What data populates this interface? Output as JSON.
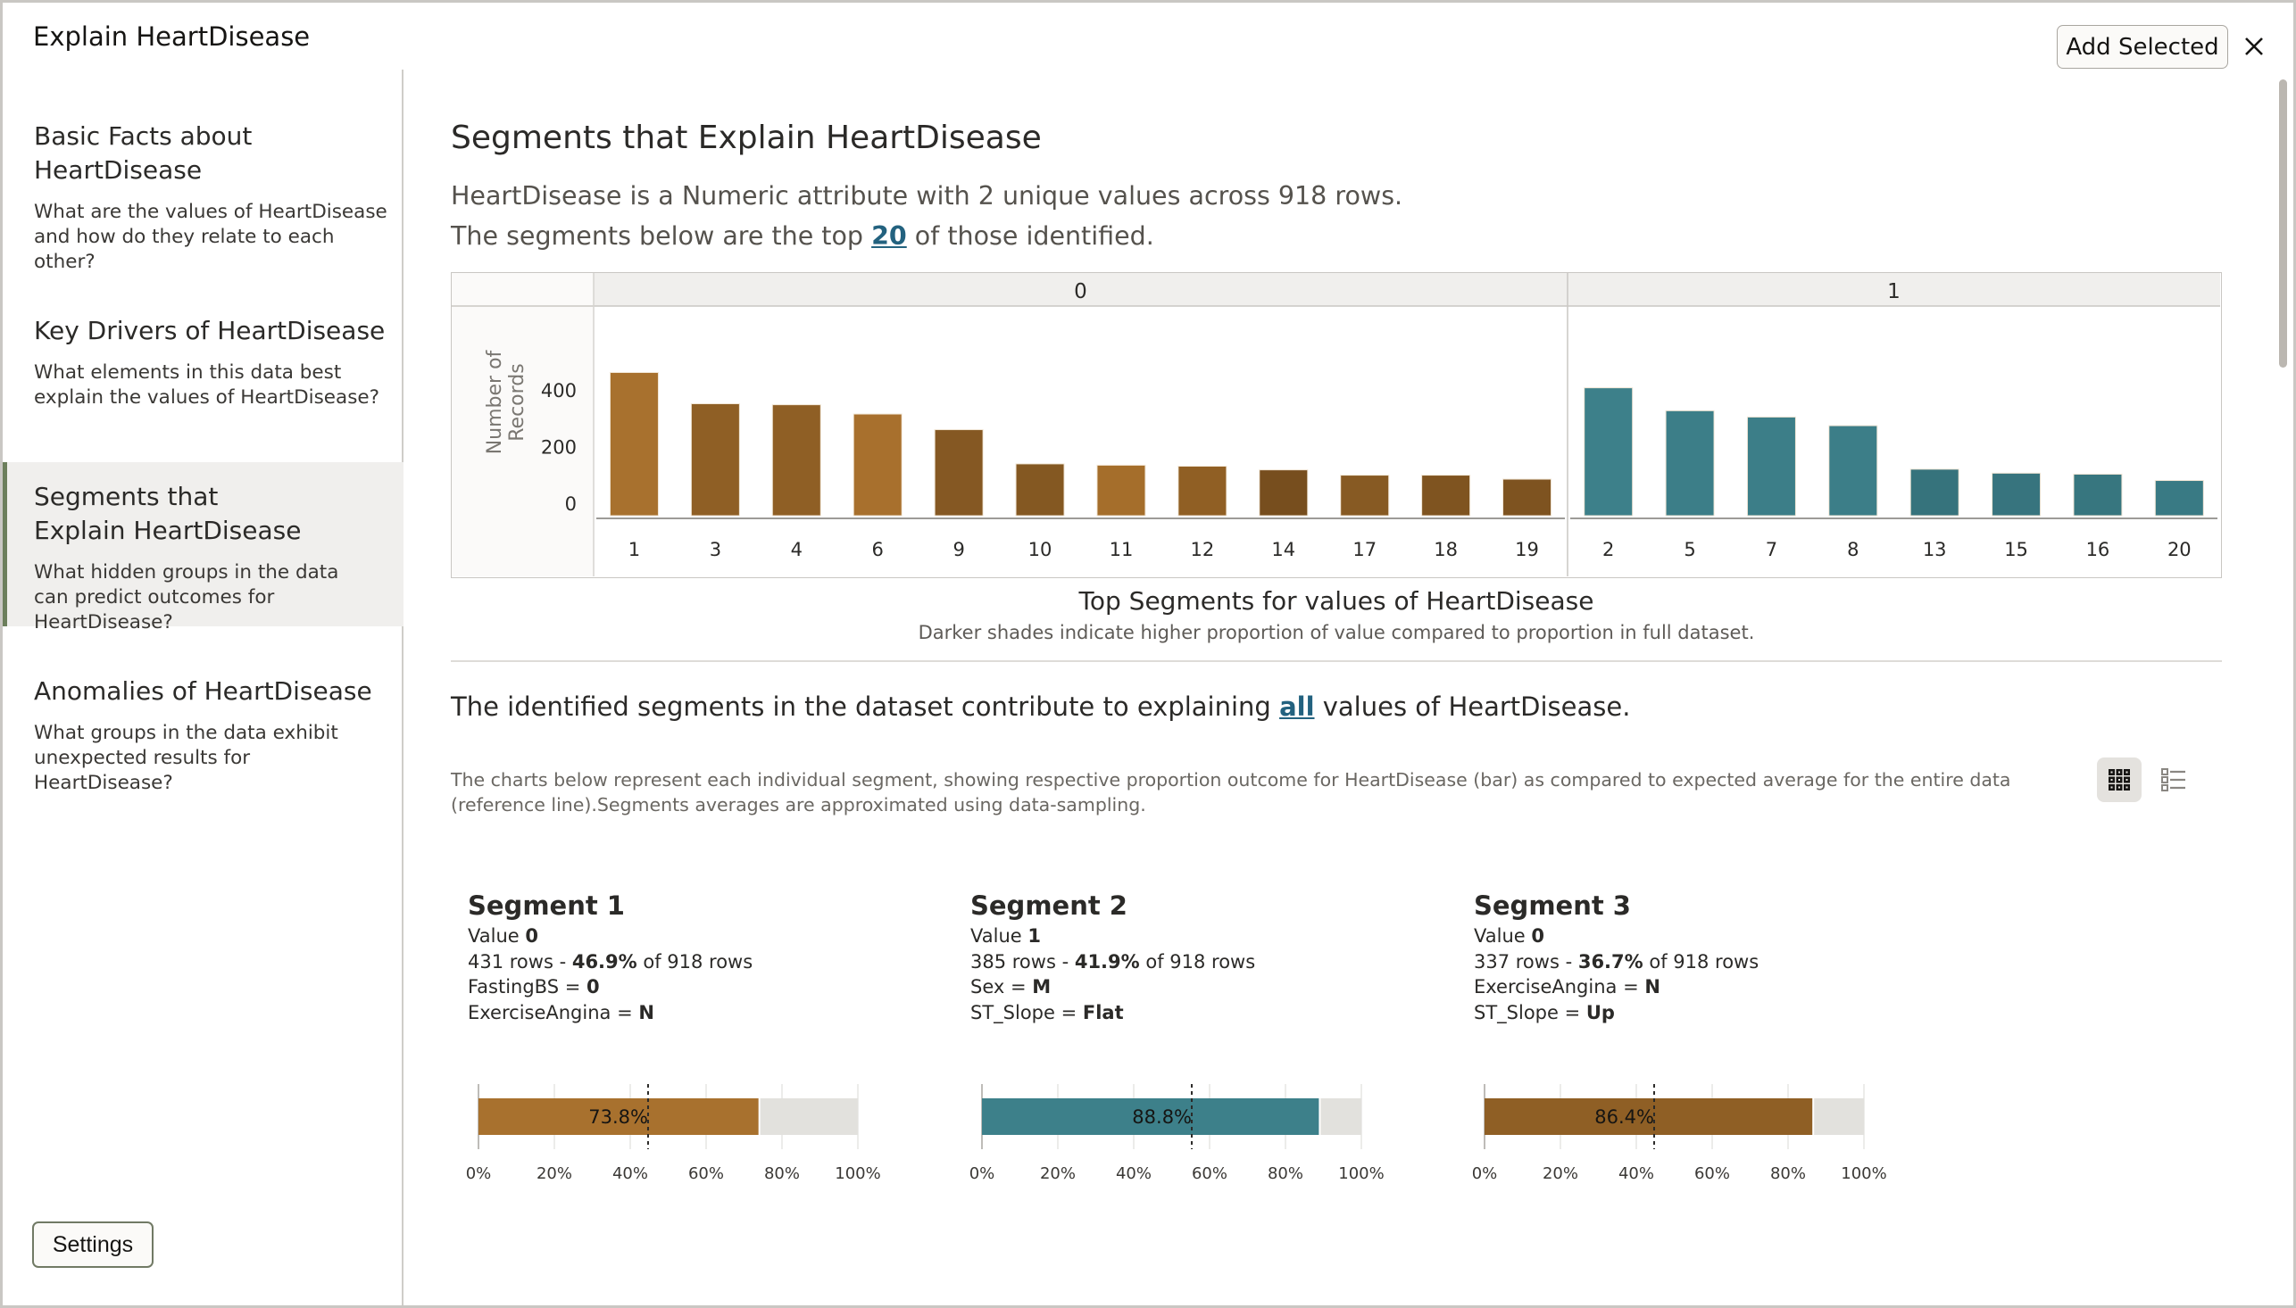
{
  "window": {
    "title": "Explain HeartDisease",
    "add_selected_label": "Add Selected",
    "close_icon": "close-icon"
  },
  "sidebar": {
    "items": [
      {
        "title": "Basic Facts about HeartDisease",
        "description": "What are the values of HeartDisease and how do they relate to each other?",
        "selected": false
      },
      {
        "title": "Key Drivers of HeartDisease",
        "description": "What elements in this data best explain the values of HeartDisease?",
        "selected": false
      },
      {
        "title": "Segments that Explain HeartDisease",
        "description": "What hidden groups in the data can predict outcomes for HeartDisease?",
        "selected": true
      },
      {
        "title": "Anomalies of HeartDisease",
        "description": "What groups in the data exhibit unexpected results for HeartDisease?",
        "selected": false
      }
    ],
    "settings_label": "Settings"
  },
  "main": {
    "heading": "Segments that Explain HeartDisease",
    "summary_line1": "HeartDisease is a Numeric attribute with 2 unique values across 918 rows.",
    "summary_line2_pre": "The segments below are the top ",
    "summary_line2_link": "20",
    "summary_line2_post": " of those identified.",
    "contrib_pre": "The identified segments in the dataset contribute to explaining ",
    "contrib_link": "all",
    "contrib_post": " values of HeartDisease.",
    "description": "The charts below represent each individual segment, showing respective proportion outcome for HeartDisease (bar) as compared to expected average for the entire data (reference line).Segments averages are approximated using data-sampling.",
    "view_toggle": [
      {
        "icon": "grid-view-icon",
        "active": true
      },
      {
        "icon": "list-view-icon",
        "active": false
      }
    ]
  },
  "colors": {
    "value0_base": "#a87030",
    "value1_base": "#3d808a",
    "link": "#23627f",
    "remainder": "#e2e1dd"
  },
  "chart_data": {
    "type": "bar",
    "title": "Top Segments for values of HeartDisease",
    "subtitle": "Darker shades indicate higher proportion of value compared to proportion in full dataset.",
    "ylabel": "Number of Records",
    "xlabel": "",
    "yticks": [
      "0",
      "200",
      "400"
    ],
    "ylim": [
      0,
      480
    ],
    "grid": false,
    "panels": [
      {
        "label": "0",
        "categories": [
          "1",
          "3",
          "4",
          "6",
          "9",
          "10",
          "11",
          "12",
          "14",
          "17",
          "18",
          "19"
        ],
        "values": [
          431,
          337,
          334,
          306,
          259,
          156,
          152,
          149,
          138,
          122,
          122,
          110
        ],
        "colors": [
          "#a8712e",
          "#8f5f25",
          "#8f5f25",
          "#a8702d",
          "#855823",
          "#845822",
          "#a56e2b",
          "#905f24",
          "#774e1e",
          "#875a23",
          "#7f5420",
          "#7e5320"
        ]
      },
      {
        "label": "1",
        "categories": [
          "2",
          "5",
          "7",
          "8",
          "13",
          "15",
          "16",
          "20"
        ],
        "values": [
          385,
          316,
          297,
          271,
          140,
          128,
          125,
          106
        ],
        "colors": [
          "#3d808a",
          "#3c7e88",
          "#3c7e88",
          "#3c7e88",
          "#36737c",
          "#37747e",
          "#37767f",
          "#397a84"
        ]
      }
    ]
  },
  "segments": [
    {
      "title": "Segment 1",
      "value_label": "Value ",
      "value": "0",
      "rows": "431 rows - ",
      "pct": "46.9%",
      "of_rows": " of 918 rows",
      "conditions": [
        {
          "attr": "FastingBS = ",
          "val": "0"
        },
        {
          "attr": "ExerciseAngina = ",
          "val": "N"
        }
      ],
      "proportion_pct": 73.8,
      "proportion_label": "73.8%",
      "reference_pct": 44.7,
      "color": "#a8712e"
    },
    {
      "title": "Segment 2",
      "value_label": "Value ",
      "value": "1",
      "rows": "385 rows - ",
      "pct": "41.9%",
      "of_rows": " of 918 rows",
      "conditions": [
        {
          "attr": "Sex = ",
          "val": "M"
        },
        {
          "attr": "ST_Slope = ",
          "val": "Flat"
        }
      ],
      "proportion_pct": 88.8,
      "proportion_label": "88.8%",
      "reference_pct": 55.3,
      "color": "#3d808a"
    },
    {
      "title": "Segment 3",
      "value_label": "Value ",
      "value": "0",
      "rows": "337 rows - ",
      "pct": "36.7%",
      "of_rows": " of 918 rows",
      "conditions": [
        {
          "attr": "ExerciseAngina = ",
          "val": "N"
        },
        {
          "attr": "ST_Slope = ",
          "val": "Up"
        }
      ],
      "proportion_pct": 86.4,
      "proportion_label": "86.4%",
      "reference_pct": 44.7,
      "color": "#8f5f25"
    }
  ],
  "segment_axis_ticks": [
    "0%",
    "20%",
    "40%",
    "60%",
    "80%",
    "100%"
  ]
}
